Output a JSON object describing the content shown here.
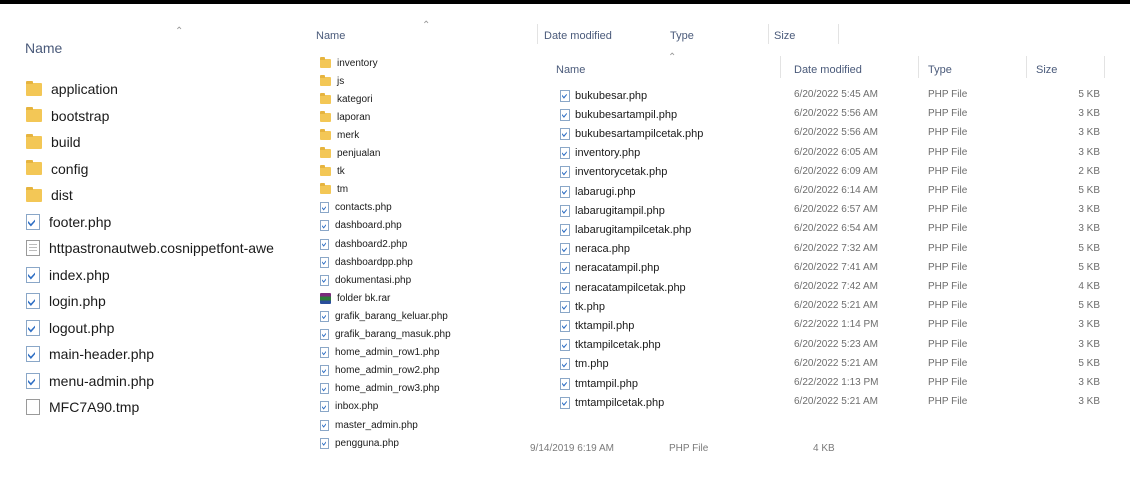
{
  "left_pane": {
    "header": "Name",
    "items": [
      {
        "name": "application",
        "icon": "folder-icon"
      },
      {
        "name": "bootstrap",
        "icon": "folder-icon"
      },
      {
        "name": "build",
        "icon": "folder-icon"
      },
      {
        "name": "config",
        "icon": "folder-icon"
      },
      {
        "name": "dist",
        "icon": "folder-icon"
      },
      {
        "name": "footer.php",
        "icon": "php-file-icon"
      },
      {
        "name": "httpastronautweb.cosnippetfont-awe",
        "icon": "text-file-icon"
      },
      {
        "name": "index.php",
        "icon": "php-file-icon"
      },
      {
        "name": "login.php",
        "icon": "php-file-icon"
      },
      {
        "name": "logout.php",
        "icon": "php-file-icon"
      },
      {
        "name": "main-header.php",
        "icon": "php-file-icon"
      },
      {
        "name": "menu-admin.php",
        "icon": "php-file-icon"
      },
      {
        "name": "MFC7A90.tmp",
        "icon": "tmp-file-icon"
      }
    ]
  },
  "middle_pane": {
    "headers": {
      "name": "Name",
      "date": "Date modified",
      "type": "Type",
      "size": "Size"
    },
    "items": [
      {
        "name": "inventory",
        "icon": "folder-icon"
      },
      {
        "name": "js",
        "icon": "folder-icon"
      },
      {
        "name": "kategori",
        "icon": "folder-icon"
      },
      {
        "name": "laporan",
        "icon": "folder-icon"
      },
      {
        "name": "merk",
        "icon": "folder-icon"
      },
      {
        "name": "penjualan",
        "icon": "folder-icon"
      },
      {
        "name": "tk",
        "icon": "folder-icon"
      },
      {
        "name": "tm",
        "icon": "folder-icon"
      },
      {
        "name": "contacts.php",
        "icon": "php-file-icon"
      },
      {
        "name": "dashboard.php",
        "icon": "php-file-icon"
      },
      {
        "name": "dashboard2.php",
        "icon": "php-file-icon"
      },
      {
        "name": "dashboardpp.php",
        "icon": "php-file-icon"
      },
      {
        "name": "dokumentasi.php",
        "icon": "php-file-icon"
      },
      {
        "name": "folder bk.rar",
        "icon": "rar-archive-icon"
      },
      {
        "name": "grafik_barang_keluar.php",
        "icon": "php-file-icon"
      },
      {
        "name": "grafik_barang_masuk.php",
        "icon": "php-file-icon"
      },
      {
        "name": "home_admin_row1.php",
        "icon": "php-file-icon"
      },
      {
        "name": "home_admin_row2.php",
        "icon": "php-file-icon"
      },
      {
        "name": "home_admin_row3.php",
        "icon": "php-file-icon"
      },
      {
        "name": "inbox.php",
        "icon": "php-file-icon"
      },
      {
        "name": "master_admin.php",
        "icon": "php-file-icon"
      },
      {
        "name": "pengguna.php",
        "icon": "php-file-icon"
      }
    ],
    "last_row": {
      "date": "9/14/2019 6:19 AM",
      "type": "PHP File",
      "size": "4 KB"
    }
  },
  "right_pane": {
    "headers": {
      "name": "Name",
      "date": "Date modified",
      "type": "Type",
      "size": "Size"
    },
    "items": [
      {
        "name": "bukubesar.php",
        "date": "6/20/2022 5:45 AM",
        "type": "PHP File",
        "size": "5 KB"
      },
      {
        "name": "bukubesartampil.php",
        "date": "6/20/2022 5:56 AM",
        "type": "PHP File",
        "size": "3 KB"
      },
      {
        "name": "bukubesartampilcetak.php",
        "date": "6/20/2022 5:56 AM",
        "type": "PHP File",
        "size": "3 KB"
      },
      {
        "name": "inventory.php",
        "date": "6/20/2022 6:05 AM",
        "type": "PHP File",
        "size": "3 KB"
      },
      {
        "name": "inventorycetak.php",
        "date": "6/20/2022 6:09 AM",
        "type": "PHP File",
        "size": "2 KB"
      },
      {
        "name": "labarugi.php",
        "date": "6/20/2022 6:14 AM",
        "type": "PHP File",
        "size": "5 KB"
      },
      {
        "name": "labarugitampil.php",
        "date": "6/20/2022 6:57 AM",
        "type": "PHP File",
        "size": "3 KB"
      },
      {
        "name": "labarugitampilcetak.php",
        "date": "6/20/2022 6:54 AM",
        "type": "PHP File",
        "size": "3 KB"
      },
      {
        "name": "neraca.php",
        "date": "6/20/2022 7:32 AM",
        "type": "PHP File",
        "size": "5 KB"
      },
      {
        "name": "neracatampil.php",
        "date": "6/20/2022 7:41 AM",
        "type": "PHP File",
        "size": "5 KB"
      },
      {
        "name": "neracatampilcetak.php",
        "date": "6/20/2022 7:42 AM",
        "type": "PHP File",
        "size": "4 KB"
      },
      {
        "name": "tk.php",
        "date": "6/20/2022 5:21 AM",
        "type": "PHP File",
        "size": "5 KB"
      },
      {
        "name": "tktampil.php",
        "date": "6/22/2022 1:14 PM",
        "type": "PHP File",
        "size": "3 KB"
      },
      {
        "name": "tktampilcetak.php",
        "date": "6/20/2022 5:23 AM",
        "type": "PHP File",
        "size": "3 KB"
      },
      {
        "name": "tm.php",
        "date": "6/20/2022 5:21 AM",
        "type": "PHP File",
        "size": "5 KB"
      },
      {
        "name": "tmtampil.php",
        "date": "6/22/2022 1:13 PM",
        "type": "PHP File",
        "size": "3 KB"
      },
      {
        "name": "tmtampilcetak.php",
        "date": "6/20/2022 5:21 AM",
        "type": "PHP File",
        "size": "3 KB"
      }
    ]
  }
}
